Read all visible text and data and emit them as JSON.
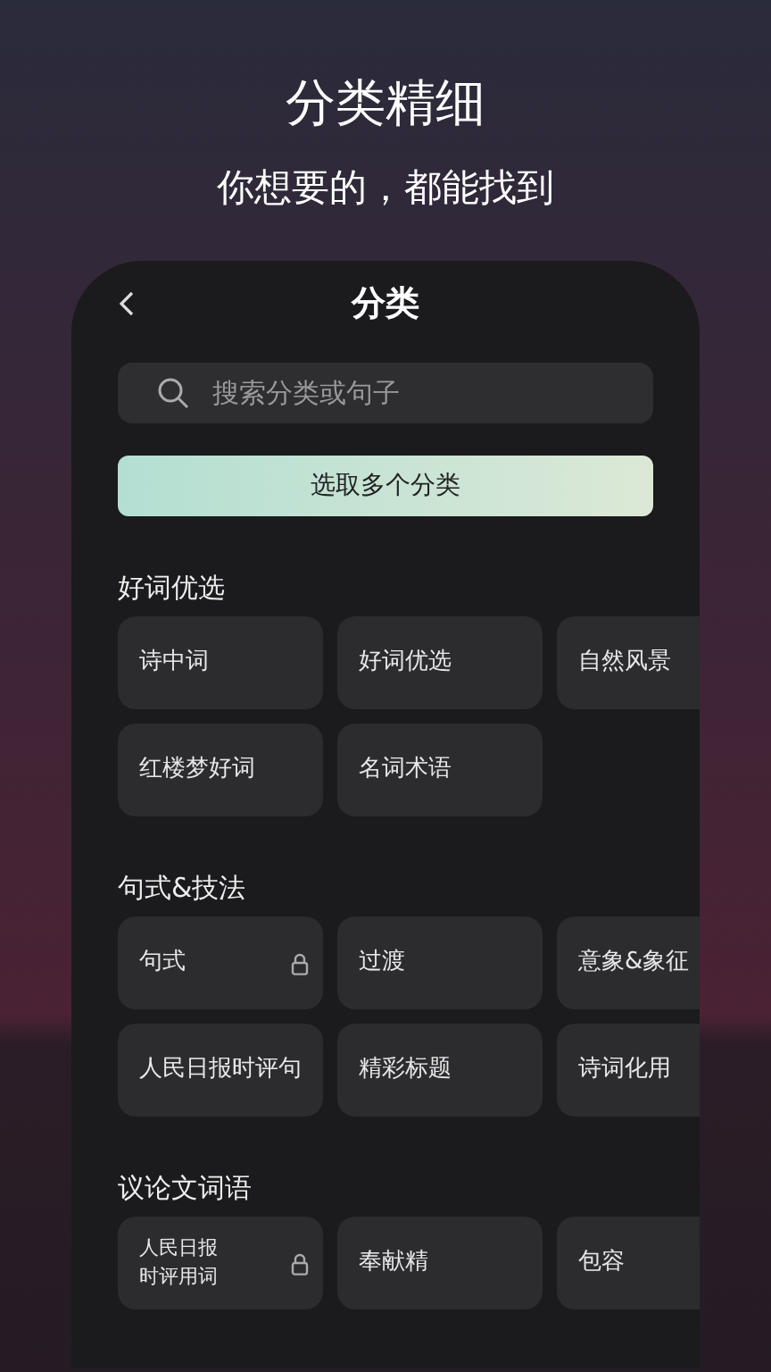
{
  "headline": "分类精细",
  "subline": "你想要的，都能找到",
  "screen": {
    "title": "分类",
    "search": {
      "placeholder": "搜索分类或句子"
    },
    "multi_select_button": "选取多个分类",
    "sections": [
      {
        "title": "好词优选",
        "items": [
          {
            "label": "诗中词",
            "locked": false
          },
          {
            "label": "好词优选",
            "locked": false
          },
          {
            "label": "自然风景",
            "locked": false
          },
          {
            "label": "红楼梦好词",
            "locked": false
          },
          {
            "label": "名词术语",
            "locked": false
          }
        ]
      },
      {
        "title": "句式&技法",
        "items": [
          {
            "label": "句式",
            "locked": true
          },
          {
            "label": "过渡",
            "locked": false
          },
          {
            "label": "意象&象征",
            "locked": false
          },
          {
            "label": "人民日报时评句",
            "locked": false
          },
          {
            "label": "精彩标题",
            "locked": false
          },
          {
            "label": "诗词化用",
            "locked": false
          }
        ]
      },
      {
        "title": "议论文词语",
        "items": [
          {
            "label": "人民日报时评用词",
            "locked": true,
            "kind": "compact"
          },
          {
            "label": "奉献精",
            "locked": false
          },
          {
            "label": "包容",
            "locked": false
          }
        ]
      }
    ]
  }
}
